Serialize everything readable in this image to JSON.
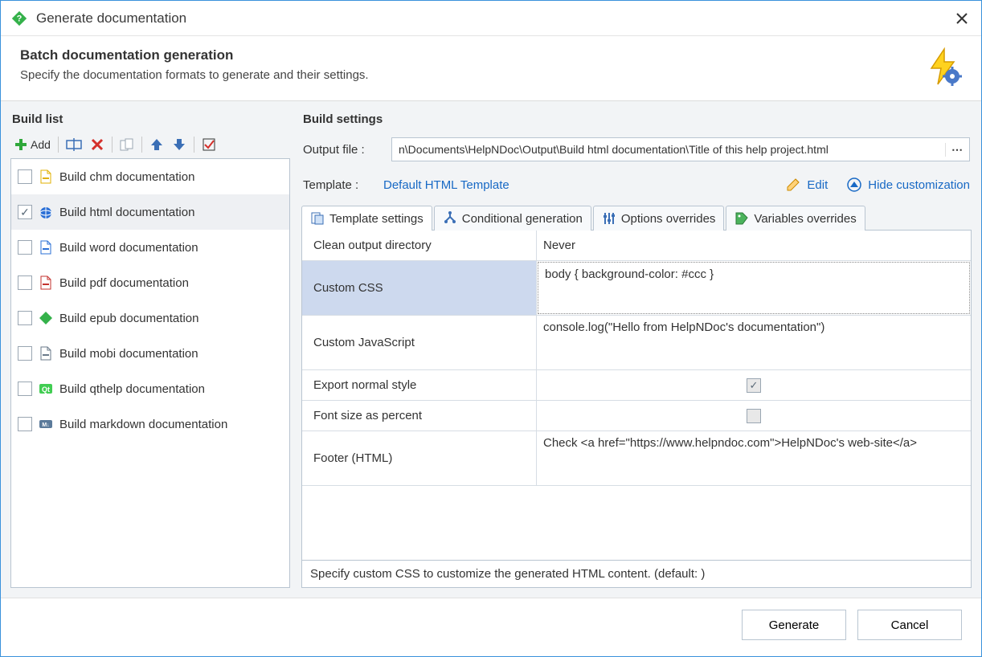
{
  "window": {
    "title": "Generate documentation"
  },
  "header": {
    "title": "Batch documentation generation",
    "subtitle": "Specify the documentation formats to generate and their settings."
  },
  "left": {
    "title": "Build list",
    "add_label": "Add",
    "items": [
      {
        "label": "Build chm documentation",
        "checked": false,
        "icon": "chm"
      },
      {
        "label": "Build html documentation",
        "checked": true,
        "icon": "html",
        "selected": true
      },
      {
        "label": "Build word documentation",
        "checked": false,
        "icon": "word"
      },
      {
        "label": "Build pdf documentation",
        "checked": false,
        "icon": "pdf"
      },
      {
        "label": "Build epub documentation",
        "checked": false,
        "icon": "epub"
      },
      {
        "label": "Build mobi documentation",
        "checked": false,
        "icon": "mobi"
      },
      {
        "label": "Build qthelp documentation",
        "checked": false,
        "icon": "qt"
      },
      {
        "label": "Build markdown documentation",
        "checked": false,
        "icon": "md"
      }
    ]
  },
  "right": {
    "title": "Build settings",
    "output_label": "Output file :",
    "output_value": "n\\Documents\\HelpNDoc\\Output\\Build html documentation\\Title of this help project.html",
    "template_label": "Template :",
    "template_value": "Default HTML Template",
    "edit_label": "Edit",
    "hide_label": "Hide customization",
    "tabs": [
      {
        "label": "Template settings"
      },
      {
        "label": "Conditional generation"
      },
      {
        "label": "Options overrides"
      },
      {
        "label": "Variables overrides"
      }
    ],
    "grid": {
      "rows": [
        {
          "key": "Clean output directory",
          "value": "Never",
          "type": "text"
        },
        {
          "key": "Custom CSS",
          "value": "body { background-color: #ccc }",
          "type": "textarea",
          "selected": true
        },
        {
          "key": "Custom JavaScript",
          "value": "console.log(\"Hello from HelpNDoc's documentation\")",
          "type": "textarea"
        },
        {
          "key": "Export normal style",
          "value": true,
          "type": "check"
        },
        {
          "key": "Font size as percent",
          "value": false,
          "type": "check"
        },
        {
          "key": "Footer (HTML)",
          "value": "Check <a href=\"https://www.helpndoc.com\">HelpNDoc's web-site</a>",
          "type": "textarea"
        }
      ]
    },
    "description": "Specify custom CSS to customize the generated HTML content. (default: )"
  },
  "footer": {
    "generate": "Generate",
    "cancel": "Cancel"
  }
}
